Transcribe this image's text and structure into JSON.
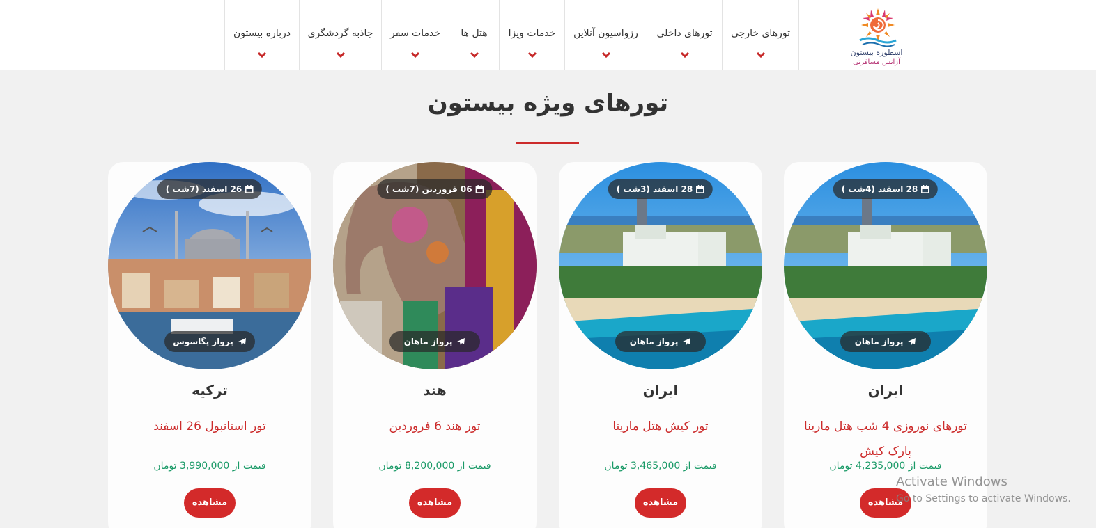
{
  "header": {
    "logo": {
      "brand": "اسطوره بیستون",
      "tagline": "آژانس مسافرتی"
    },
    "nav": [
      {
        "label": "تورهای خارجی"
      },
      {
        "label": "تورهای داخلی"
      },
      {
        "label": "رزواسیون آنلاین"
      },
      {
        "label": "خدمات ویزا"
      },
      {
        "label": "هتل ها"
      },
      {
        "label": "خدمات سفر"
      },
      {
        "label": "جاذبه گردشگری"
      },
      {
        "label": "درباره بیستون"
      }
    ]
  },
  "section": {
    "title": "تورهای ویژه بیستون"
  },
  "cards": [
    {
      "date": "28 اسفند (4شب )",
      "flight": "پرواز ماهان",
      "country": "ایران",
      "title": "تورهای نوروزی 4 شب هتل مارینا پارک کیش",
      "price": "قیمت از 4,235,000 تومان",
      "button": "مشاهده"
    },
    {
      "date": "28 اسفند (3شب )",
      "flight": "پرواز ماهان",
      "country": "ایران",
      "title": "تور کیش هتل مارینا",
      "price": "قیمت از 3,465,000 تومان",
      "button": "مشاهده"
    },
    {
      "date": "06 فروردین (7شب )",
      "flight": "پرواز ماهان",
      "country": "هند",
      "title": "تور هند 6 فروردین",
      "price": "قیمت از 8,200,000 تومان",
      "button": "مشاهده"
    },
    {
      "date": "26 اسفند (7شب )",
      "flight": "پرواز پگاسوس",
      "country": "ترکیه",
      "title": "تور استانبول 26 اسفند",
      "price": "قیمت از 3,990,000 تومان",
      "button": "مشاهده"
    }
  ],
  "icons": {
    "date": "calendar-icon",
    "flight": "plane-icon",
    "nav": "chevron-down-icon"
  },
  "colors": {
    "accent": "#d32a2a",
    "price": "#1a9a67",
    "background": "#f1f1f1"
  },
  "watermark": {
    "line1": "Activate Windows",
    "line2": "Go to Settings to activate Windows."
  }
}
